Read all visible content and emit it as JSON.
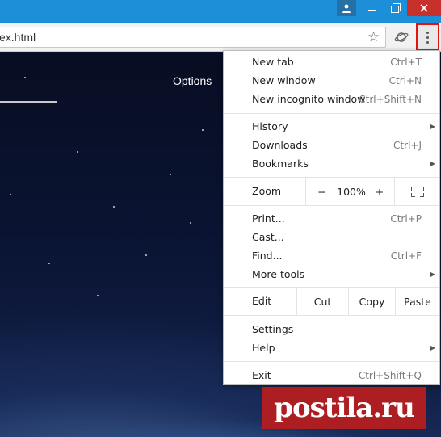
{
  "address_bar": {
    "url_fragment": "ex.html"
  },
  "page": {
    "options_label": "Options"
  },
  "menu": {
    "items": {
      "new_tab": {
        "label": "New tab",
        "shortcut": "Ctrl+T"
      },
      "new_window": {
        "label": "New window",
        "shortcut": "Ctrl+N"
      },
      "new_incognito": {
        "label": "New incognito window",
        "shortcut": "Ctrl+Shift+N"
      },
      "history": {
        "label": "History"
      },
      "downloads": {
        "label": "Downloads",
        "shortcut": "Ctrl+J"
      },
      "bookmarks": {
        "label": "Bookmarks"
      },
      "print": {
        "label": "Print...",
        "shortcut": "Ctrl+P"
      },
      "cast": {
        "label": "Cast..."
      },
      "find": {
        "label": "Find...",
        "shortcut": "Ctrl+F"
      },
      "more_tools": {
        "label": "More tools"
      },
      "settings": {
        "label": "Settings"
      },
      "help": {
        "label": "Help"
      },
      "exit": {
        "label": "Exit",
        "shortcut": "Ctrl+Shift+Q"
      }
    },
    "zoom": {
      "label": "Zoom",
      "minus": "−",
      "value": "100%",
      "plus": "+"
    },
    "edit": {
      "label": "Edit",
      "cut": "Cut",
      "copy": "Copy",
      "paste": "Paste"
    }
  },
  "watermark": {
    "text": "postila.ru"
  },
  "icons": {
    "profile": "profile-icon",
    "minimize": "minimize-icon",
    "maximize": "restore-icon",
    "close": "close-icon",
    "bookmark": "star-icon",
    "extension": "planet-icon",
    "menu": "kebab-menu-icon",
    "submenu": "triangle-right-icon",
    "fullscreen": "fullscreen-icon"
  },
  "colors": {
    "titlebar": "#1d8fd9",
    "close_button": "#c7302b",
    "menu_highlight_border": "#e2140f",
    "watermark_bg": "#ad1e23"
  }
}
